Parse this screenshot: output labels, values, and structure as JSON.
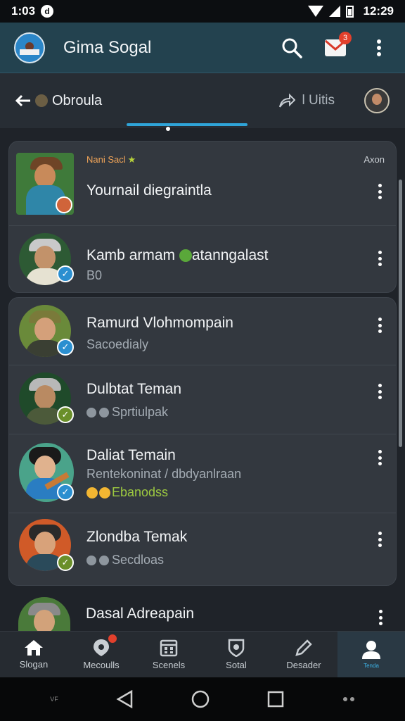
{
  "status_bar": {
    "time": "1:03",
    "time_right": "12:29",
    "notification_glyph": "d"
  },
  "app_bar": {
    "title": "Gima Sogal",
    "icons": [
      "search-icon",
      "mail-icon",
      "more-vert-icon"
    ],
    "mail_badge": "3",
    "colors": {
      "background": "#23424f"
    }
  },
  "sub_header": {
    "title": "Obroula",
    "share_label": "l Uitis",
    "icons": [
      "back-arrow-icon",
      "share-icon"
    ]
  },
  "section1": {
    "items": [
      {
        "tag": "Nani Sacl",
        "time": "Axon",
        "title": "Yournail diegraintla",
        "subtitle": ""
      },
      {
        "title": "Kamb armam",
        "title_suffix": "atanngalast",
        "subtitle": "B0"
      }
    ]
  },
  "section2": {
    "items": [
      {
        "title": "Ramurd Vlohmompain",
        "subtitle": "Sacoedialy"
      },
      {
        "title": "Dulbtat Teman",
        "subtitle": "Sprtiulpak"
      },
      {
        "title": "Daliat Temain",
        "subtitle": "Rentekoninat / dbdyanlraan",
        "subtitle2": "Ebanodss"
      },
      {
        "title": "Zlondba Temak",
        "subtitle": "Secdloas"
      }
    ]
  },
  "partial_item": {
    "title": "Dasal Adreapain"
  },
  "bottom_nav": {
    "items": [
      {
        "label": "Slogan",
        "icon": "home-icon"
      },
      {
        "label": "Mecoulls",
        "icon": "pin-icon",
        "badge": ""
      },
      {
        "label": "Scenels",
        "icon": "calendar-icon"
      },
      {
        "label": "Sotal",
        "icon": "badge-icon"
      },
      {
        "label": "Desader",
        "icon": "pencil-icon"
      },
      {
        "label": "Tenda",
        "icon": "person-icon"
      }
    ],
    "active_index": 5
  },
  "system_nav": {
    "left_text": "VF"
  }
}
